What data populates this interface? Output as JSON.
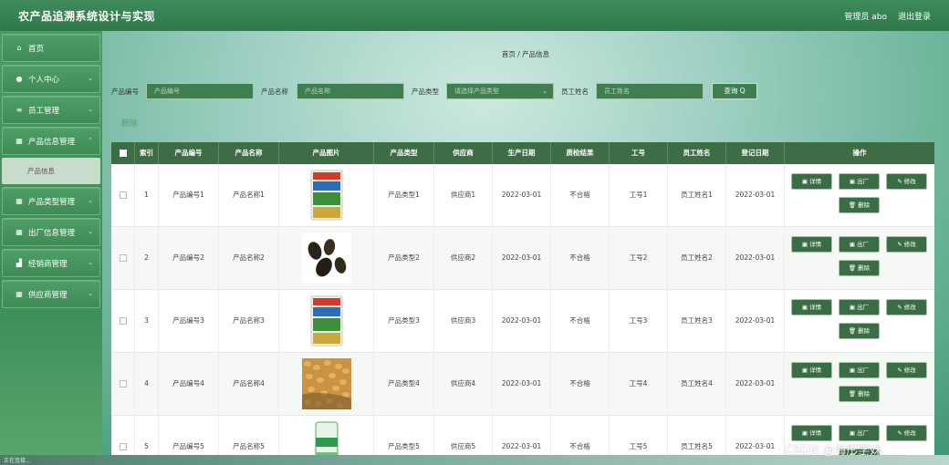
{
  "header": {
    "title": "农产品追溯系统设计与实现",
    "user_label": "管理员 abo",
    "logout": "退出登录"
  },
  "sidebar": {
    "items": [
      {
        "label": "首页",
        "icon": "home-icon"
      },
      {
        "label": "个人中心",
        "icon": "user-icon"
      },
      {
        "label": "员工管理",
        "icon": "list-icon"
      },
      {
        "label": "产品信息管理",
        "icon": "grid-icon",
        "expanded": true,
        "sub": "产品信息"
      },
      {
        "label": "产品类型管理",
        "icon": "grid-icon"
      },
      {
        "label": "出厂信息管理",
        "icon": "grid-icon"
      },
      {
        "label": "经销商管理",
        "icon": "chart-icon"
      },
      {
        "label": "供应商管理",
        "icon": "grid-icon"
      }
    ]
  },
  "breadcrumb": "首页 / 产品信息",
  "search": {
    "label1": "产品编号",
    "placeholder1": "产品编号",
    "label2": "产品名称",
    "placeholder2": "产品名称",
    "label3": "产品类型",
    "placeholder3": "请选择产品类型",
    "label4": "员工姓名",
    "placeholder4": "员工姓名",
    "button": "查询 Q"
  },
  "delete_label": "删除",
  "table": {
    "headers": [
      "索引",
      "产品编号",
      "产品名称",
      "产品图片",
      "产品类型",
      "供应商",
      "生产日期",
      "质检结果",
      "工号",
      "员工姓名",
      "登记日期",
      "操作"
    ],
    "rows": [
      {
        "idx": "1",
        "code": "产品编号1",
        "name": "产品名称1",
        "type": "产品类型1",
        "supplier": "供应商1",
        "date": "2022-03-01",
        "qc": "不合格",
        "job": "工号1",
        "emp": "员工姓名1",
        "reg": "2022-03-01",
        "img": "seed-bag-green"
      },
      {
        "idx": "2",
        "code": "产品编号2",
        "name": "产品名称2",
        "type": "产品类型2",
        "supplier": "供应商2",
        "date": "2022-03-01",
        "qc": "不合格",
        "job": "工号2",
        "emp": "员工姓名2",
        "reg": "2022-03-01",
        "img": "dark-seeds"
      },
      {
        "idx": "3",
        "code": "产品编号3",
        "name": "产品名称3",
        "type": "产品类型3",
        "supplier": "供应商3",
        "date": "2022-03-01",
        "qc": "不合格",
        "job": "工号3",
        "emp": "员工姓名3",
        "reg": "2022-03-01",
        "img": "seed-bag-green"
      },
      {
        "idx": "4",
        "code": "产品编号4",
        "name": "产品名称4",
        "type": "产品类型4",
        "supplier": "供应商4",
        "date": "2022-03-01",
        "qc": "不合格",
        "job": "工号4",
        "emp": "员工姓名4",
        "reg": "2022-03-01",
        "img": "grain-pile"
      },
      {
        "idx": "5",
        "code": "产品编号5",
        "name": "产品名称5",
        "type": "产品类型5",
        "supplier": "供应商5",
        "date": "2022-03-01",
        "qc": "不合格",
        "job": "工号5",
        "emp": "员工姓名5",
        "reg": "2022-03-01",
        "img": "seed-bag-light"
      }
    ],
    "actions": {
      "detail": "详情",
      "out": "出厂",
      "edit": "修改",
      "delete": "删除"
    }
  },
  "statusbar": "正在连接...",
  "watermark": "CSDN @海彤学妹",
  "colors": {
    "header": "#2f7a4b",
    "sidebar": "#4d9a62",
    "table_head": "#3d6d45",
    "button": "#3a6d44"
  }
}
